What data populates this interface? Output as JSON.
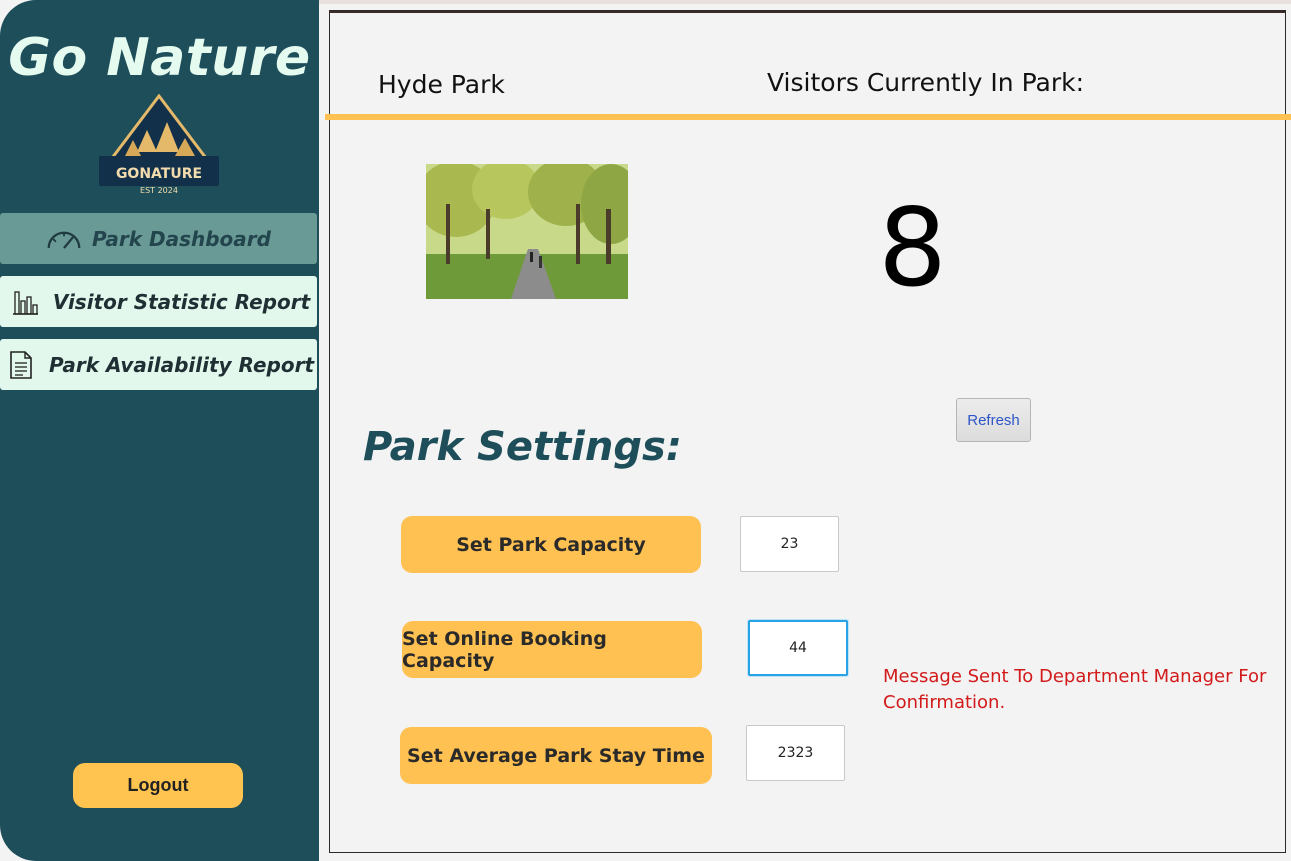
{
  "sidebar": {
    "brand_title": "Go Nature",
    "logo": {
      "name": "GONATURE",
      "tagline": "EST 2024"
    },
    "nav_items": [
      {
        "label": "Park Dashboard",
        "icon": "gauge-icon",
        "active": true
      },
      {
        "label": "Visitor Statistic Report",
        "icon": "bar-chart-icon",
        "active": false
      },
      {
        "label": "Park Availability Report",
        "icon": "document-icon",
        "active": false
      }
    ],
    "logout_label": "Logout"
  },
  "header": {
    "park_name": "Hyde Park",
    "visitors_label": "Visitors Currently In Park:"
  },
  "dashboard": {
    "visitor_count": "8",
    "refresh_label": "Refresh"
  },
  "settings": {
    "title": "Park Settings:",
    "capacity": {
      "label": "Set Park Capacity",
      "value": "23"
    },
    "online_capacity": {
      "label": "Set Online Booking Capacity",
      "value": "44"
    },
    "stay_time": {
      "label": "Set Average Park Stay Time",
      "value": "2323"
    },
    "message": "Message Sent To Department Manager For Confirmation."
  },
  "colors": {
    "sidebar_bg": "#1d4e5a",
    "accent": "#ffc151",
    "message": "#d21a1a",
    "nav_active": "#6a9a95",
    "nav_bg": "#e3f8ec"
  }
}
